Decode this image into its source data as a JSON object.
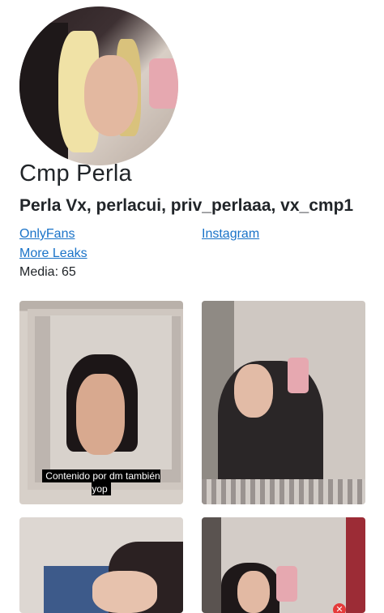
{
  "profile": {
    "name": "Cmp Perla",
    "aliases": "Perla Vx, perlacui, priv_perlaaa, vx_cmp1",
    "links": [
      "OnlyFans",
      "Instagram",
      "More Leaks"
    ],
    "media_label": "Media:",
    "media_count": "65"
  },
  "gallery": {
    "items": [
      {
        "caption": "Contenido por dm también yop"
      },
      {
        "caption": ""
      },
      {
        "caption": ""
      },
      {
        "caption": ""
      }
    ],
    "badge_icon": "close-icon"
  },
  "colors": {
    "link": "#1a73c8",
    "text": "#212529"
  }
}
